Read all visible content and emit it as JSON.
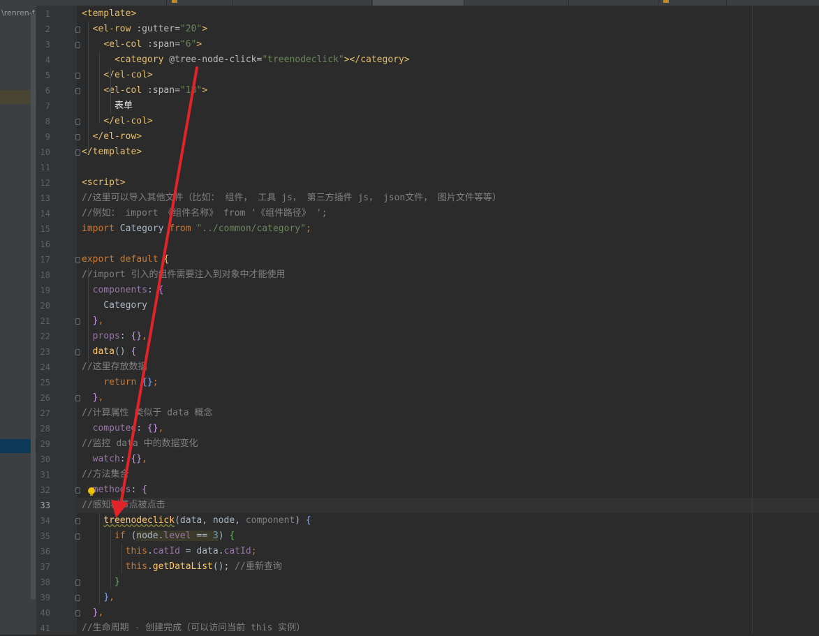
{
  "sidebar": {
    "path_fragment": "\\renren-f"
  },
  "editor": {
    "current_line": 33,
    "lines": [
      {
        "n": "1",
        "segs": [
          {
            "t": "<template>",
            "c": "tag"
          }
        ]
      },
      {
        "n": "2",
        "segs": [
          {
            "t": "  "
          },
          {
            "t": "<el-row ",
            "c": "tag"
          },
          {
            "t": ":gutter=",
            "c": "attr"
          },
          {
            "t": "\"20\"",
            "c": "str"
          },
          {
            "t": ">",
            "c": "tag"
          }
        ]
      },
      {
        "n": "3",
        "segs": [
          {
            "t": "    "
          },
          {
            "t": "<el-col ",
            "c": "tag"
          },
          {
            "t": ":span=",
            "c": "attr"
          },
          {
            "t": "\"6\"",
            "c": "str"
          },
          {
            "t": ">",
            "c": "tag"
          }
        ]
      },
      {
        "n": "4",
        "segs": [
          {
            "t": "      "
          },
          {
            "t": "<category ",
            "c": "tag"
          },
          {
            "t": "@tree-node-click=",
            "c": "attr"
          },
          {
            "t": "\"treenodeclick\"",
            "c": "str"
          },
          {
            "t": "></category>",
            "c": "tag"
          }
        ]
      },
      {
        "n": "5",
        "segs": [
          {
            "t": "    "
          },
          {
            "t": "</el-col>",
            "c": "tag"
          }
        ]
      },
      {
        "n": "6",
        "segs": [
          {
            "t": "    "
          },
          {
            "t": "<el-col ",
            "c": "tag"
          },
          {
            "t": ":span=",
            "c": "attr"
          },
          {
            "t": "\"18\"",
            "c": "str"
          },
          {
            "t": ">",
            "c": "tag"
          }
        ]
      },
      {
        "n": "7",
        "segs": [
          {
            "t": "      "
          },
          {
            "t": "表单",
            "c": "cn"
          }
        ]
      },
      {
        "n": "8",
        "segs": [
          {
            "t": "    "
          },
          {
            "t": "</el-col>",
            "c": "tag"
          }
        ]
      },
      {
        "n": "9",
        "segs": [
          {
            "t": "  "
          },
          {
            "t": "</el-row>",
            "c": "tag"
          }
        ]
      },
      {
        "n": "10",
        "segs": [
          {
            "t": "</template>",
            "c": "tag"
          }
        ]
      },
      {
        "n": "11",
        "segs": []
      },
      {
        "n": "12",
        "segs": [
          {
            "t": "<script>",
            "c": "tag"
          }
        ]
      },
      {
        "n": "13",
        "segs": [
          {
            "t": "//这里可以导入其他文件（比如： 组件， 工具 js， 第三方插件 js， json文件， 图片文件等等）",
            "c": "cm"
          }
        ]
      },
      {
        "n": "14",
        "segs": [
          {
            "t": "//例如： import 《组件名称》 from '《组件路径》 ';",
            "c": "cm"
          }
        ]
      },
      {
        "n": "15",
        "segs": [
          {
            "t": "import ",
            "c": "kw"
          },
          {
            "t": "Category "
          },
          {
            "t": "from ",
            "c": "kw"
          },
          {
            "t": "\"../common/category\"",
            "c": "str"
          },
          {
            "t": ";",
            "c": "kw"
          }
        ]
      },
      {
        "n": "16",
        "segs": []
      },
      {
        "n": "17",
        "segs": [
          {
            "t": "export default ",
            "c": "kw"
          },
          {
            "t": "{",
            "c": "br1"
          }
        ]
      },
      {
        "n": "18",
        "segs": [
          {
            "t": "//import 引入的组件需要注入到对象中才能使用",
            "c": "cm"
          }
        ]
      },
      {
        "n": "19",
        "segs": [
          {
            "t": "  "
          },
          {
            "t": "components",
            "c": "prop"
          },
          {
            "t": ": "
          },
          {
            "t": "{",
            "c": "br2"
          }
        ]
      },
      {
        "n": "20",
        "segs": [
          {
            "t": "    Category"
          }
        ]
      },
      {
        "n": "21",
        "segs": [
          {
            "t": "  "
          },
          {
            "t": "}",
            "c": "br2"
          },
          {
            "t": ",",
            "c": "kw"
          }
        ]
      },
      {
        "n": "22",
        "segs": [
          {
            "t": "  "
          },
          {
            "t": "props",
            "c": "prop"
          },
          {
            "t": ": "
          },
          {
            "t": "{}",
            "c": "br2"
          },
          {
            "t": ",",
            "c": "kw"
          }
        ]
      },
      {
        "n": "23",
        "segs": [
          {
            "t": "  "
          },
          {
            "t": "data",
            "c": "fn"
          },
          {
            "t": "() "
          },
          {
            "t": "{",
            "c": "br2"
          }
        ]
      },
      {
        "n": "24",
        "segs": [
          {
            "t": "//这里存放数据",
            "c": "cm"
          }
        ]
      },
      {
        "n": "25",
        "segs": [
          {
            "t": "    "
          },
          {
            "t": "return ",
            "c": "kw"
          },
          {
            "t": "{}",
            "c": "br3"
          },
          {
            "t": ";",
            "c": "kw"
          }
        ]
      },
      {
        "n": "26",
        "segs": [
          {
            "t": "  "
          },
          {
            "t": "}",
            "c": "br2"
          },
          {
            "t": ",",
            "c": "kw"
          }
        ]
      },
      {
        "n": "27",
        "segs": [
          {
            "t": "//计算属性 类似于 data 概念",
            "c": "cm"
          }
        ]
      },
      {
        "n": "28",
        "segs": [
          {
            "t": "  "
          },
          {
            "t": "computed",
            "c": "prop"
          },
          {
            "t": ": "
          },
          {
            "t": "{}",
            "c": "br2"
          },
          {
            "t": ",",
            "c": "kw"
          }
        ]
      },
      {
        "n": "29",
        "segs": [
          {
            "t": "//监控 data 中的数据变化",
            "c": "cm"
          }
        ]
      },
      {
        "n": "30",
        "segs": [
          {
            "t": "  "
          },
          {
            "t": "watch",
            "c": "prop"
          },
          {
            "t": ": "
          },
          {
            "t": "{}",
            "c": "br2"
          },
          {
            "t": ",",
            "c": "kw"
          }
        ]
      },
      {
        "n": "31",
        "segs": [
          {
            "t": "//方法集合",
            "c": "cm"
          }
        ]
      },
      {
        "n": "32",
        "segs": [
          {
            "t": "  "
          },
          {
            "t": "methods",
            "c": "prop"
          },
          {
            "t": ": "
          },
          {
            "t": "{",
            "c": "br2"
          }
        ]
      },
      {
        "n": "33",
        "segs": [
          {
            "t": "//感知树节点被点击",
            "c": "cm"
          }
        ]
      },
      {
        "n": "34",
        "segs": [
          {
            "t": "    "
          },
          {
            "t": "treenodeclick",
            "c": "fn",
            "u": true
          },
          {
            "t": "(data, node, "
          },
          {
            "t": "component",
            "c": "cm"
          },
          {
            "t": ") "
          },
          {
            "t": "{",
            "c": "br3"
          }
        ]
      },
      {
        "n": "35",
        "segs": [
          {
            "t": "      "
          },
          {
            "t": "if ",
            "c": "kw"
          },
          {
            "t": "("
          },
          {
            "t": "node.",
            "h": true
          },
          {
            "t": "level",
            "c": "prop",
            "h": true
          },
          {
            "t": " == ",
            "h": true
          },
          {
            "t": "3",
            "c": "num",
            "h": true
          },
          {
            "t": ") "
          },
          {
            "t": "{",
            "c": "br4"
          }
        ]
      },
      {
        "n": "36",
        "segs": [
          {
            "t": "        "
          },
          {
            "t": "this",
            "c": "kw"
          },
          {
            "t": "."
          },
          {
            "t": "catId",
            "c": "prop"
          },
          {
            "t": " = data."
          },
          {
            "t": "catId",
            "c": "prop"
          },
          {
            "t": ";",
            "c": "kw"
          }
        ]
      },
      {
        "n": "37",
        "segs": [
          {
            "t": "        "
          },
          {
            "t": "this",
            "c": "kw"
          },
          {
            "t": "."
          },
          {
            "t": "getDataList",
            "c": "fn"
          },
          {
            "t": "(); "
          },
          {
            "t": "//重新查询",
            "c": "cm"
          }
        ]
      },
      {
        "n": "38",
        "segs": [
          {
            "t": "      "
          },
          {
            "t": "}",
            "c": "br4"
          }
        ]
      },
      {
        "n": "39",
        "segs": [
          {
            "t": "    "
          },
          {
            "t": "}",
            "c": "br3"
          },
          {
            "t": ",",
            "c": "kw"
          }
        ]
      },
      {
        "n": "40",
        "segs": [
          {
            "t": "  "
          },
          {
            "t": "}",
            "c": "br2"
          },
          {
            "t": ",",
            "c": "kw"
          }
        ]
      },
      {
        "n": "41",
        "segs": [
          {
            "t": "//生命周期 - 创建完成（可以访问当前 this 实例）",
            "c": "cm"
          }
        ]
      }
    ]
  },
  "colors": {
    "background": "#2b2b2b",
    "annotation_arrow": "#e0242a"
  }
}
